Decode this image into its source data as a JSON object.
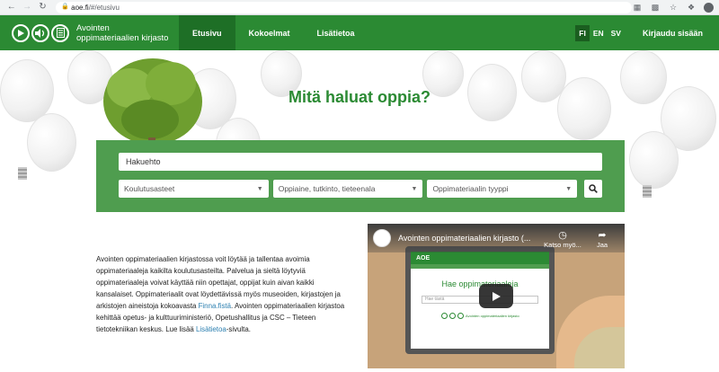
{
  "browser": {
    "url_host": "aoe.fi",
    "url_rest": "/#/etusivu"
  },
  "header": {
    "logo_text": "Avointen oppimateriaalien kirjasto",
    "nav": [
      {
        "label": "Etusivu"
      },
      {
        "label": "Kokoelmat"
      },
      {
        "label": "Lisätietoa"
      }
    ],
    "languages": [
      {
        "label": "FI"
      },
      {
        "label": "EN"
      },
      {
        "label": "SV"
      }
    ],
    "login_label": "Kirjaudu sisään"
  },
  "hero": {
    "title": "Mitä haluat oppia?"
  },
  "search": {
    "placeholder": "Hakuehto",
    "filters": [
      {
        "label": "Koulutusasteet"
      },
      {
        "label": "Oppiaine, tutkinto, tieteenala"
      },
      {
        "label": "Oppimateriaalin tyyppi"
      }
    ]
  },
  "intro": {
    "text_before_finna": "Avointen oppimateriaalien kirjastossa voit löytää ja tallentaa avoimia oppimateriaaleja kaikilta koulutusasteilta. Palvelua ja sieltä löytyviä oppimateriaaleja voivat käyttää niin opettajat, oppijat kuin aivan kaikki kansalaiset. Oppimateriaalit ovat löydettävissä myös museoiden, kirjastojen ja arkistojen aineistoja kokoavasta ",
    "finna_link": "Finna.fistä",
    "text_middle": ". Avointen oppimateriaalien kirjastoa kehittää opetus- ja kulttuuriministeriö, Opetushallitus ja CSC – Tieteen tietotekniikan keskus. Lue lisää ",
    "lisatietoa_link": "Lisätietoa",
    "text_end": "-sivulta."
  },
  "video": {
    "title": "Avointen oppimateriaalien kirjasto (...",
    "watch_later": "Katso myö...",
    "share": "Jaa",
    "screen_brand": "AOE",
    "screen_heading": "Hae oppimateriaaleja",
    "screen_search_placeholder": "Hae tästä",
    "screen_logo_text": "Avointen oppimateriaalien kirjasto"
  },
  "colors": {
    "brand_green": "#2b8a33",
    "panel_green": "#4f9d4f",
    "link_blue": "#2b7fb0"
  }
}
